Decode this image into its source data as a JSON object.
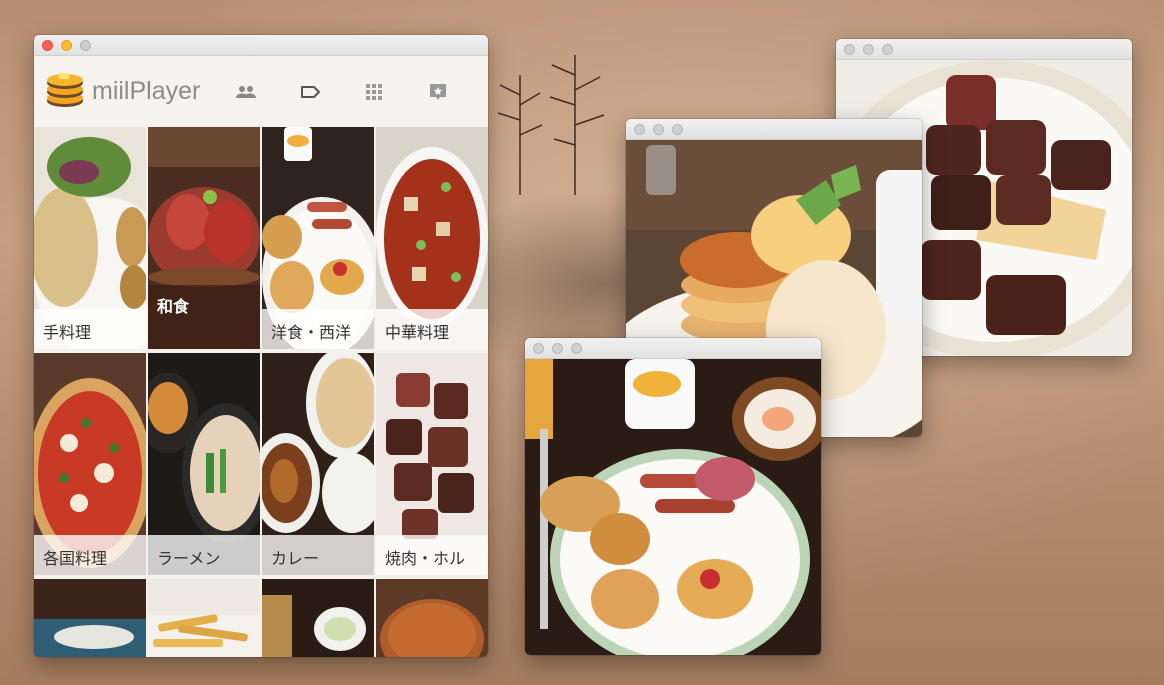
{
  "app": {
    "brand": "miilPlayer",
    "nav_icons": [
      "people-icon",
      "tag-icon",
      "grid-icon",
      "sparkle-comment-icon"
    ]
  },
  "categories": [
    {
      "label": "手料理"
    },
    {
      "label": "和食"
    },
    {
      "label": "洋食・西洋"
    },
    {
      "label": "中華料理"
    },
    {
      "label": "各国料理"
    },
    {
      "label": "ラーメン"
    },
    {
      "label": "カレー"
    },
    {
      "label": "焼肉・ホル"
    }
  ],
  "photo_windows": [
    "steak-photo",
    "pancake-photo",
    "breakfast-photo"
  ],
  "colors": {
    "window_bg": "#f5f2ec",
    "brand_text": "#8b8b8b",
    "label_bg": "#ffffff",
    "close": "#fc5f57",
    "minimize": "#fdbc2e"
  }
}
